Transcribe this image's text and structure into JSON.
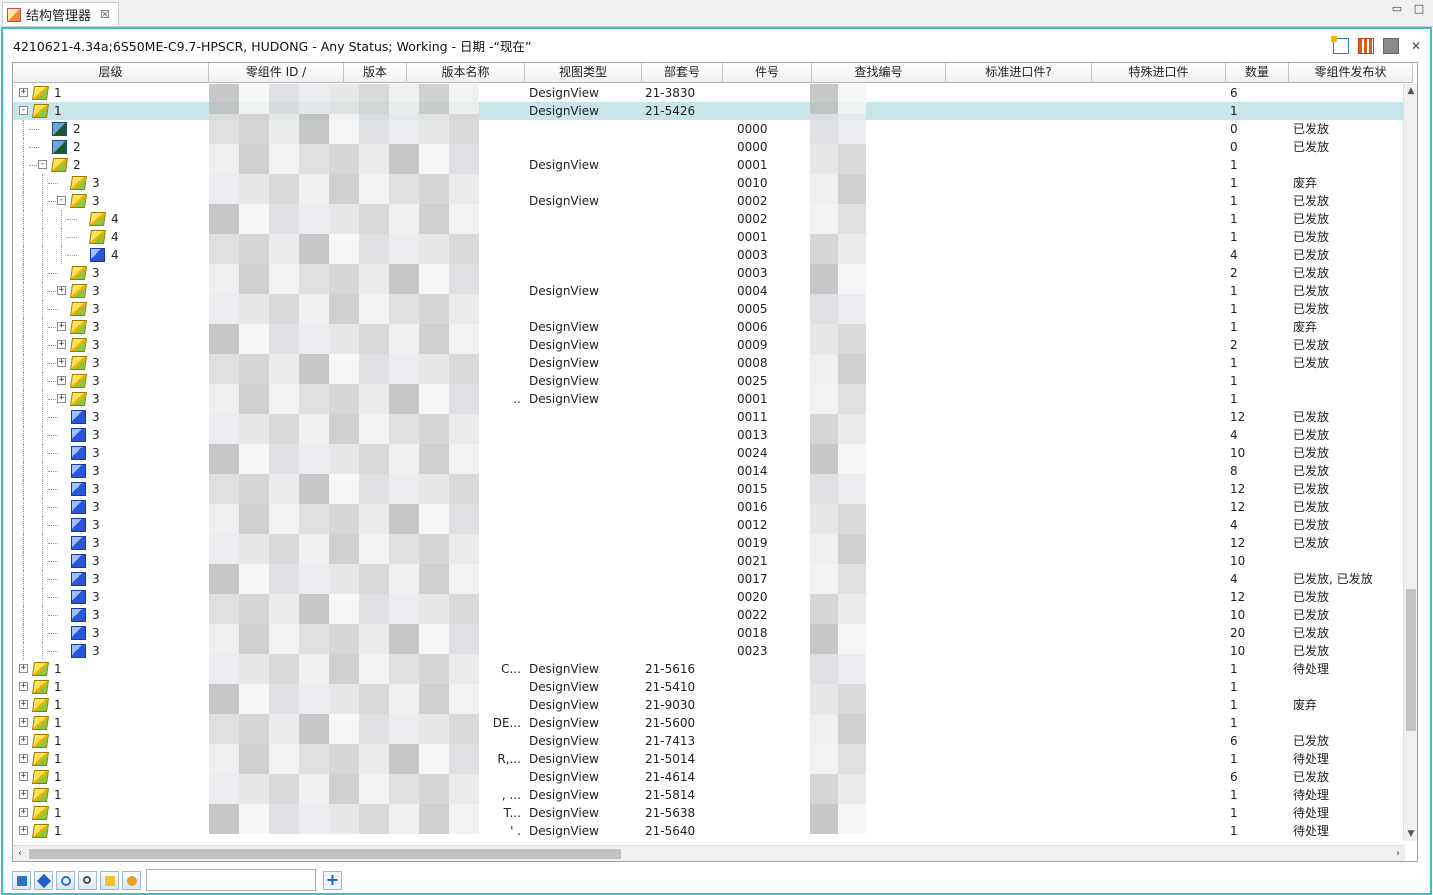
{
  "tab": {
    "title": "结构管理器",
    "close": "☒"
  },
  "window_controls": {
    "minimize": "▭",
    "maximize": "□"
  },
  "context": "4210621-4.34a;6S50ME-C9.7-HPSCR, HUDONG - Any Status; Working - 日期 -“现在”",
  "columns": [
    "层级",
    "零组件 ID /",
    "版本",
    "版本名称",
    "视图类型",
    "部套号",
    "件号",
    "查找编号",
    "标准进口件?",
    "特殊进口件",
    "数量",
    "零组件发布状"
  ],
  "rows": [
    {
      "level": "1",
      "depth": 0,
      "icon": "asm",
      "exp": "+",
      "vname": "",
      "vtype": "DesignView",
      "asm": "21-3830",
      "part": "",
      "qty": "6",
      "status": ""
    },
    {
      "level": "1",
      "depth": 0,
      "icon": "asm",
      "exp": "-",
      "vname": "",
      "vtype": "DesignView",
      "asm": "21-5426",
      "part": "",
      "qty": "1",
      "status": "",
      "selected": true
    },
    {
      "level": "2",
      "depth": 1,
      "icon": "doc",
      "exp": "",
      "vname": "",
      "vtype": "",
      "asm": "",
      "part": "0000",
      "qty": "0",
      "status": "已发放"
    },
    {
      "level": "2",
      "depth": 1,
      "icon": "doc",
      "exp": "",
      "vname": "",
      "vtype": "",
      "asm": "",
      "part": "0000",
      "qty": "0",
      "status": "已发放"
    },
    {
      "level": "2",
      "depth": 1,
      "icon": "asm",
      "exp": "-",
      "vname": "",
      "vtype": "DesignView",
      "asm": "",
      "part": "0001",
      "qty": "1",
      "status": ""
    },
    {
      "level": "3",
      "depth": 2,
      "icon": "asm",
      "exp": "",
      "vname": "",
      "vtype": "",
      "asm": "",
      "part": "0010",
      "qty": "1",
      "status": "废弃"
    },
    {
      "level": "3",
      "depth": 2,
      "icon": "asm",
      "exp": "-",
      "vname": "",
      "vtype": "DesignView",
      "asm": "",
      "part": "0002",
      "qty": "1",
      "status": "已发放"
    },
    {
      "level": "4",
      "depth": 3,
      "icon": "asm",
      "exp": "",
      "vname": "",
      "vtype": "",
      "asm": "",
      "part": "0002",
      "qty": "1",
      "status": "已发放"
    },
    {
      "level": "4",
      "depth": 3,
      "icon": "asm",
      "exp": "",
      "vname": "",
      "vtype": "",
      "asm": "",
      "part": "0001",
      "qty": "1",
      "status": "已发放"
    },
    {
      "level": "4",
      "depth": 3,
      "icon": "part",
      "exp": "",
      "vname": "",
      "vtype": "",
      "asm": "",
      "part": "0003",
      "qty": "4",
      "status": "已发放"
    },
    {
      "level": "3",
      "depth": 2,
      "icon": "asm",
      "exp": "",
      "vname": "",
      "vtype": "",
      "asm": "",
      "part": "0003",
      "qty": "2",
      "status": "已发放"
    },
    {
      "level": "3",
      "depth": 2,
      "icon": "asm",
      "exp": "+",
      "vname": "",
      "vtype": "DesignView",
      "asm": "",
      "part": "0004",
      "qty": "1",
      "status": "已发放"
    },
    {
      "level": "3",
      "depth": 2,
      "icon": "asm",
      "exp": "",
      "vname": "",
      "vtype": "",
      "asm": "",
      "part": "0005",
      "qty": "1",
      "status": "已发放"
    },
    {
      "level": "3",
      "depth": 2,
      "icon": "asm",
      "exp": "+",
      "vname": "",
      "vtype": "DesignView",
      "asm": "",
      "part": "0006",
      "qty": "1",
      "status": "废弃"
    },
    {
      "level": "3",
      "depth": 2,
      "icon": "asm",
      "exp": "+",
      "vname": "",
      "vtype": "DesignView",
      "asm": "",
      "part": "0009",
      "qty": "2",
      "status": "已发放"
    },
    {
      "level": "3",
      "depth": 2,
      "icon": "asm",
      "exp": "+",
      "vname": "",
      "vtype": "DesignView",
      "asm": "",
      "part": "0008",
      "qty": "1",
      "status": "已发放"
    },
    {
      "level": "3",
      "depth": 2,
      "icon": "asm",
      "exp": "+",
      "vname": "",
      "vtype": "DesignView",
      "asm": "",
      "part": "0025",
      "qty": "1",
      "status": ""
    },
    {
      "level": "3",
      "depth": 2,
      "icon": "asm",
      "exp": "+",
      "vname": "..",
      "vtype": "DesignView",
      "asm": "",
      "part": "0001",
      "qty": "1",
      "status": ""
    },
    {
      "level": "3",
      "depth": 2,
      "icon": "part",
      "exp": "",
      "vname": "",
      "vtype": "",
      "asm": "",
      "part": "0011",
      "qty": "12",
      "status": "已发放"
    },
    {
      "level": "3",
      "depth": 2,
      "icon": "part",
      "exp": "",
      "vname": "",
      "vtype": "",
      "asm": "",
      "part": "0013",
      "qty": "4",
      "status": "已发放"
    },
    {
      "level": "3",
      "depth": 2,
      "icon": "part",
      "exp": "",
      "vname": "",
      "vtype": "",
      "asm": "",
      "part": "0024",
      "qty": "10",
      "status": "已发放"
    },
    {
      "level": "3",
      "depth": 2,
      "icon": "part",
      "exp": "",
      "vname": "",
      "vtype": "",
      "asm": "",
      "part": "0014",
      "qty": "8",
      "status": "已发放"
    },
    {
      "level": "3",
      "depth": 2,
      "icon": "part",
      "exp": "",
      "vname": "",
      "vtype": "",
      "asm": "",
      "part": "0015",
      "qty": "12",
      "status": "已发放"
    },
    {
      "level": "3",
      "depth": 2,
      "icon": "part",
      "exp": "",
      "vname": "",
      "vtype": "",
      "asm": "",
      "part": "0016",
      "qty": "12",
      "status": "已发放"
    },
    {
      "level": "3",
      "depth": 2,
      "icon": "part",
      "exp": "",
      "vname": "",
      "vtype": "",
      "asm": "",
      "part": "0012",
      "qty": "4",
      "status": "已发放"
    },
    {
      "level": "3",
      "depth": 2,
      "icon": "part",
      "exp": "",
      "vname": "",
      "vtype": "",
      "asm": "",
      "part": "0019",
      "qty": "12",
      "status": "已发放"
    },
    {
      "level": "3",
      "depth": 2,
      "icon": "part",
      "exp": "",
      "vname": "",
      "vtype": "",
      "asm": "",
      "part": "0021",
      "qty": "10",
      "status": ""
    },
    {
      "level": "3",
      "depth": 2,
      "icon": "part",
      "exp": "",
      "vname": "",
      "vtype": "",
      "asm": "",
      "part": "0017",
      "qty": "4",
      "status": "已发放, 已发放"
    },
    {
      "level": "3",
      "depth": 2,
      "icon": "part",
      "exp": "",
      "vname": "",
      "vtype": "",
      "asm": "",
      "part": "0020",
      "qty": "12",
      "status": "已发放"
    },
    {
      "level": "3",
      "depth": 2,
      "icon": "part",
      "exp": "",
      "vname": "",
      "vtype": "",
      "asm": "",
      "part": "0022",
      "qty": "10",
      "status": "已发放"
    },
    {
      "level": "3",
      "depth": 2,
      "icon": "part",
      "exp": "",
      "vname": "",
      "vtype": "",
      "asm": "",
      "part": "0018",
      "qty": "20",
      "status": "已发放"
    },
    {
      "level": "3",
      "depth": 2,
      "icon": "part",
      "exp": "",
      "vname": "",
      "vtype": "",
      "asm": "",
      "part": "0023",
      "qty": "10",
      "status": "已发放"
    },
    {
      "level": "1",
      "depth": 0,
      "icon": "asm",
      "exp": "+",
      "vname": "C...",
      "vtype": "DesignView",
      "asm": "21-5616",
      "part": "",
      "qty": "1",
      "status": "待处理"
    },
    {
      "level": "1",
      "depth": 0,
      "icon": "asm",
      "exp": "+",
      "vname": "",
      "vtype": "DesignView",
      "asm": "21-5410",
      "part": "",
      "qty": "1",
      "status": ""
    },
    {
      "level": "1",
      "depth": 0,
      "icon": "asm",
      "exp": "+",
      "vname": "",
      "vtype": "DesignView",
      "asm": "21-9030",
      "part": "",
      "qty": "1",
      "status": "废弃"
    },
    {
      "level": "1",
      "depth": 0,
      "icon": "asm",
      "exp": "+",
      "vname": "DE...",
      "vtype": "DesignView",
      "asm": "21-5600",
      "part": "",
      "qty": "1",
      "status": ""
    },
    {
      "level": "1",
      "depth": 0,
      "icon": "asm",
      "exp": "+",
      "vname": "",
      "vtype": "DesignView",
      "asm": "21-7413",
      "part": "",
      "qty": "6",
      "status": "已发放"
    },
    {
      "level": "1",
      "depth": 0,
      "icon": "asm",
      "exp": "+",
      "vname": "R,...",
      "vtype": "DesignView",
      "asm": "21-5014",
      "part": "",
      "qty": "1",
      "status": "待处理"
    },
    {
      "level": "1",
      "depth": 0,
      "icon": "asm",
      "exp": "+",
      "vname": "",
      "vtype": "DesignView",
      "asm": "21-4614",
      "part": "",
      "qty": "6",
      "status": "已发放"
    },
    {
      "level": "1",
      "depth": 0,
      "icon": "asm",
      "exp": "+",
      "vname": ", ...",
      "vtype": "DesignView",
      "asm": "21-5814",
      "part": "",
      "qty": "1",
      "status": "待处理"
    },
    {
      "level": "1",
      "depth": 0,
      "icon": "asm",
      "exp": "+",
      "vname": "T...",
      "vtype": "DesignView",
      "asm": "21-5638",
      "part": "",
      "qty": "1",
      "status": "待处理"
    },
    {
      "level": "1",
      "depth": 0,
      "icon": "asm",
      "exp": "+",
      "vname": "' .",
      "vtype": "DesignView",
      "asm": "21-5640",
      "part": "",
      "qty": "1",
      "status": "待处理"
    }
  ],
  "bottom": {
    "add": "+",
    "search_value": ""
  }
}
